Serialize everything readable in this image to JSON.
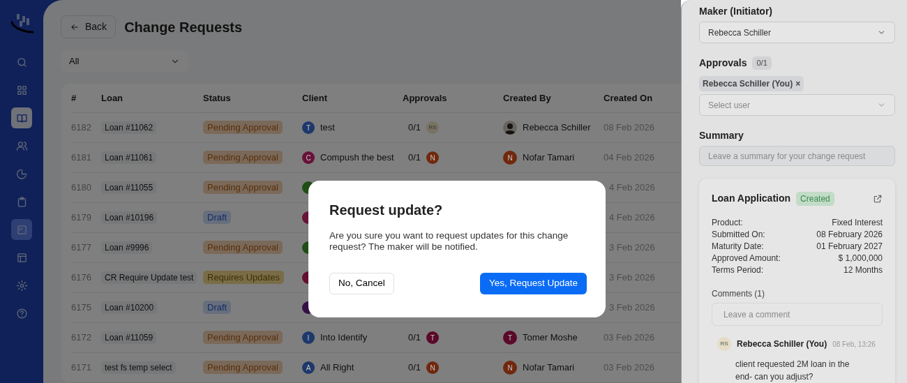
{
  "sidebar": {
    "items": [
      {
        "kind": "search",
        "selected": false,
        "hovered": false
      },
      {
        "kind": "grid",
        "selected": false,
        "hovered": false
      },
      {
        "kind": "book",
        "selected": true,
        "hovered": false
      },
      {
        "kind": "users",
        "selected": false,
        "hovered": false
      },
      {
        "kind": "pie",
        "selected": false,
        "hovered": false
      },
      {
        "kind": "clipboard",
        "selected": false,
        "hovered": false
      },
      {
        "kind": "board",
        "selected": false,
        "hovered": true
      },
      {
        "kind": "table",
        "selected": false,
        "hovered": false
      },
      {
        "kind": "gear",
        "selected": false,
        "hovered": false
      },
      {
        "kind": "help",
        "selected": false,
        "hovered": false
      }
    ]
  },
  "header": {
    "back": "Back",
    "title": "Change Requests"
  },
  "filter": {
    "value": "All"
  },
  "table": {
    "columns": [
      "#",
      "Loan",
      "Status",
      "Client",
      "Approvals",
      "Created By",
      "Created On"
    ],
    "rows": [
      {
        "id": "6182",
        "loan": "Loan #11062",
        "status": {
          "label": "Pending Approval",
          "kind": "pending"
        },
        "client": {
          "initial": "T",
          "name": "test",
          "color": "#1e386b"
        },
        "approvals": {
          "count": "0/1",
          "initials": "RS",
          "color": "#787262"
        },
        "created_by": {
          "kind": "photo",
          "name": "Rebecca Schiller"
        },
        "created_on": "08 Feb 2026"
      },
      {
        "id": "6181",
        "loan": "Loan #11061",
        "status": {
          "label": "Pending Approval",
          "kind": "pending"
        },
        "client": {
          "initial": "C",
          "name": "Compush the best",
          "color": "#681238"
        },
        "approvals": {
          "count": "0/1",
          "initials": "N",
          "color": "#70280e"
        },
        "created_by": {
          "kind": "initial",
          "initial": "N",
          "name": "Nofar Tamari",
          "color": "#70280e"
        },
        "created_on": "04 Feb 2026"
      },
      {
        "id": "6180",
        "loan": "Loan #11055",
        "status": {
          "label": "Pending Approval",
          "kind": "pending"
        },
        "client": {
          "color": "#204e16"
        },
        "created_on": "4 Feb 2026"
      },
      {
        "id": "6179",
        "loan": "Loan #10196",
        "status": {
          "label": "Draft",
          "kind": "draft"
        },
        "client": {
          "color": "#681238"
        },
        "created_on": "4 Feb 2026"
      },
      {
        "id": "6177",
        "loan": "Loan #9996",
        "status": {
          "label": "Pending Approval",
          "kind": "pending"
        },
        "client": {
          "color": "#204e16"
        },
        "created_on": "3 Feb 2026"
      },
      {
        "id": "6176",
        "loan": "CR Require Update test",
        "status": {
          "label": "Requires Updates",
          "kind": "requires_updates"
        },
        "client": {
          "color": "#640f32"
        },
        "created_on": "3 Feb 2026"
      },
      {
        "id": "6175",
        "loan": "Loan #10200",
        "status": {
          "label": "Draft",
          "kind": "draft"
        },
        "client": {
          "color": "#350f45"
        },
        "created_on": "3 Feb 2026"
      },
      {
        "id": "6172",
        "loan": "Loan #11059",
        "status": {
          "label": "Pending Approval",
          "kind": "pending"
        },
        "client": {
          "initial": "I",
          "name": "Into Identify",
          "color": "#1e386b"
        },
        "approvals": {
          "count": "0/1",
          "initials": "T",
          "color": "#5a0928"
        },
        "created_by": {
          "kind": "initial",
          "initial": "T",
          "name": "Tomer Moshe",
          "color": "#5a0928"
        },
        "created_on": "03 Feb 2026"
      },
      {
        "id": "6171",
        "loan": "test fs temp select",
        "status": {
          "label": "Pending Approval",
          "kind": "pending"
        },
        "client": {
          "initial": "A",
          "name": "All Right",
          "color": "#1e386b"
        },
        "approvals": {
          "count": "0/1",
          "initials": "N",
          "color": "#70280e"
        },
        "created_by": {
          "kind": "initial",
          "initial": "N",
          "name": "Nofar Tamari",
          "color": "#70280e"
        },
        "created_on": "03 Feb 2026"
      }
    ]
  },
  "panel": {
    "maker_label": "Maker (Initiator)",
    "maker_value": "Rebecca Schiller",
    "approvals_label": "Approvals",
    "approvals_count": "0/1",
    "approver_chip": "Rebecca Schiller (You)",
    "chip_remove": "×",
    "select_placeholder": "Select user",
    "summary_label": "Summary",
    "summary_placeholder": "Leave a summary for your change request",
    "card": {
      "title": "Loan Application",
      "badge": "Created",
      "details": [
        {
          "label": "Product:",
          "value": "Fixed Interest"
        },
        {
          "label": "Submitted On:",
          "value": "08 February 2026"
        },
        {
          "label": "Maturity Date:",
          "value": "01 February 2027"
        },
        {
          "label": "Approved Amount:",
          "value": "$ 1,000,000"
        },
        {
          "label": "Terms Period:",
          "value": "12 Months"
        }
      ],
      "comments_label": "Comments (1)",
      "comment_placeholder": "Leave a comment",
      "comments": [
        {
          "initials": "RS",
          "author": "Rebecca Schiller (You)",
          "time": "08 Feb, 13:26",
          "text": "client requested 2M loan in the end- can you adjust?"
        }
      ]
    }
  },
  "modal": {
    "title": "Request update?",
    "message": "Are you sure you want to request updates for this change request? The maker will be notified.",
    "cancel": "No, Cancel",
    "confirm": "Yes, Request Update"
  }
}
